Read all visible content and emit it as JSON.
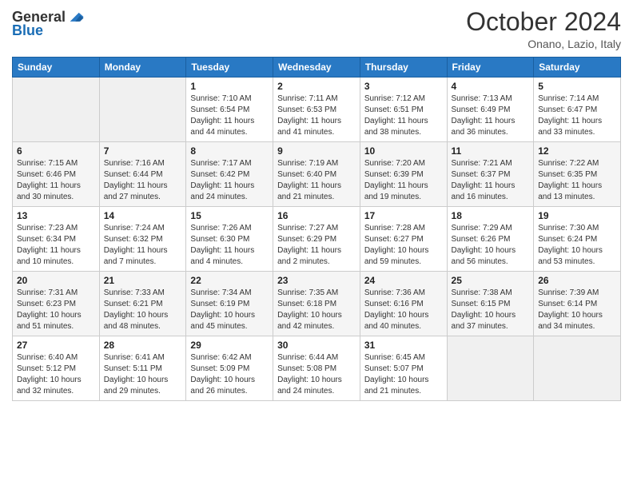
{
  "header": {
    "logo_general": "General",
    "logo_blue": "Blue",
    "title": "October 2024",
    "subtitle": "Onano, Lazio, Italy"
  },
  "weekdays": [
    "Sunday",
    "Monday",
    "Tuesday",
    "Wednesday",
    "Thursday",
    "Friday",
    "Saturday"
  ],
  "weeks": [
    [
      {
        "day": "",
        "info": ""
      },
      {
        "day": "",
        "info": ""
      },
      {
        "day": "1",
        "info": "Sunrise: 7:10 AM\nSunset: 6:54 PM\nDaylight: 11 hours and 44 minutes."
      },
      {
        "day": "2",
        "info": "Sunrise: 7:11 AM\nSunset: 6:53 PM\nDaylight: 11 hours and 41 minutes."
      },
      {
        "day": "3",
        "info": "Sunrise: 7:12 AM\nSunset: 6:51 PM\nDaylight: 11 hours and 38 minutes."
      },
      {
        "day": "4",
        "info": "Sunrise: 7:13 AM\nSunset: 6:49 PM\nDaylight: 11 hours and 36 minutes."
      },
      {
        "day": "5",
        "info": "Sunrise: 7:14 AM\nSunset: 6:47 PM\nDaylight: 11 hours and 33 minutes."
      }
    ],
    [
      {
        "day": "6",
        "info": "Sunrise: 7:15 AM\nSunset: 6:46 PM\nDaylight: 11 hours and 30 minutes."
      },
      {
        "day": "7",
        "info": "Sunrise: 7:16 AM\nSunset: 6:44 PM\nDaylight: 11 hours and 27 minutes."
      },
      {
        "day": "8",
        "info": "Sunrise: 7:17 AM\nSunset: 6:42 PM\nDaylight: 11 hours and 24 minutes."
      },
      {
        "day": "9",
        "info": "Sunrise: 7:19 AM\nSunset: 6:40 PM\nDaylight: 11 hours and 21 minutes."
      },
      {
        "day": "10",
        "info": "Sunrise: 7:20 AM\nSunset: 6:39 PM\nDaylight: 11 hours and 19 minutes."
      },
      {
        "day": "11",
        "info": "Sunrise: 7:21 AM\nSunset: 6:37 PM\nDaylight: 11 hours and 16 minutes."
      },
      {
        "day": "12",
        "info": "Sunrise: 7:22 AM\nSunset: 6:35 PM\nDaylight: 11 hours and 13 minutes."
      }
    ],
    [
      {
        "day": "13",
        "info": "Sunrise: 7:23 AM\nSunset: 6:34 PM\nDaylight: 11 hours and 10 minutes."
      },
      {
        "day": "14",
        "info": "Sunrise: 7:24 AM\nSunset: 6:32 PM\nDaylight: 11 hours and 7 minutes."
      },
      {
        "day": "15",
        "info": "Sunrise: 7:26 AM\nSunset: 6:30 PM\nDaylight: 11 hours and 4 minutes."
      },
      {
        "day": "16",
        "info": "Sunrise: 7:27 AM\nSunset: 6:29 PM\nDaylight: 11 hours and 2 minutes."
      },
      {
        "day": "17",
        "info": "Sunrise: 7:28 AM\nSunset: 6:27 PM\nDaylight: 10 hours and 59 minutes."
      },
      {
        "day": "18",
        "info": "Sunrise: 7:29 AM\nSunset: 6:26 PM\nDaylight: 10 hours and 56 minutes."
      },
      {
        "day": "19",
        "info": "Sunrise: 7:30 AM\nSunset: 6:24 PM\nDaylight: 10 hours and 53 minutes."
      }
    ],
    [
      {
        "day": "20",
        "info": "Sunrise: 7:31 AM\nSunset: 6:23 PM\nDaylight: 10 hours and 51 minutes."
      },
      {
        "day": "21",
        "info": "Sunrise: 7:33 AM\nSunset: 6:21 PM\nDaylight: 10 hours and 48 minutes."
      },
      {
        "day": "22",
        "info": "Sunrise: 7:34 AM\nSunset: 6:19 PM\nDaylight: 10 hours and 45 minutes."
      },
      {
        "day": "23",
        "info": "Sunrise: 7:35 AM\nSunset: 6:18 PM\nDaylight: 10 hours and 42 minutes."
      },
      {
        "day": "24",
        "info": "Sunrise: 7:36 AM\nSunset: 6:16 PM\nDaylight: 10 hours and 40 minutes."
      },
      {
        "day": "25",
        "info": "Sunrise: 7:38 AM\nSunset: 6:15 PM\nDaylight: 10 hours and 37 minutes."
      },
      {
        "day": "26",
        "info": "Sunrise: 7:39 AM\nSunset: 6:14 PM\nDaylight: 10 hours and 34 minutes."
      }
    ],
    [
      {
        "day": "27",
        "info": "Sunrise: 6:40 AM\nSunset: 5:12 PM\nDaylight: 10 hours and 32 minutes."
      },
      {
        "day": "28",
        "info": "Sunrise: 6:41 AM\nSunset: 5:11 PM\nDaylight: 10 hours and 29 minutes."
      },
      {
        "day": "29",
        "info": "Sunrise: 6:42 AM\nSunset: 5:09 PM\nDaylight: 10 hours and 26 minutes."
      },
      {
        "day": "30",
        "info": "Sunrise: 6:44 AM\nSunset: 5:08 PM\nDaylight: 10 hours and 24 minutes."
      },
      {
        "day": "31",
        "info": "Sunrise: 6:45 AM\nSunset: 5:07 PM\nDaylight: 10 hours and 21 minutes."
      },
      {
        "day": "",
        "info": ""
      },
      {
        "day": "",
        "info": ""
      }
    ]
  ]
}
